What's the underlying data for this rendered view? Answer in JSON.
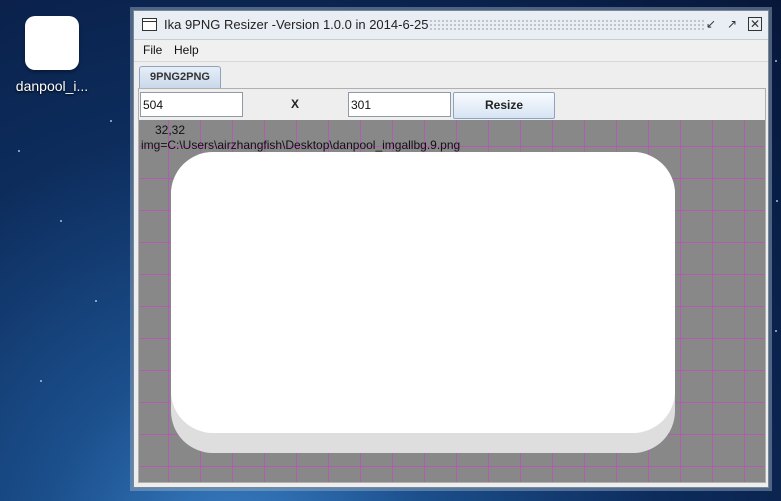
{
  "desktop": {
    "icon_label": "danpool_i..."
  },
  "window": {
    "title": "Ika 9PNG Resizer    -Version 1.0.0 in 2014-6-25",
    "controls": [
      "minimize-icon",
      "maximize-icon",
      "close-icon"
    ]
  },
  "menu": {
    "file": "File",
    "help": "Help"
  },
  "tabs": [
    {
      "label": "9PNG2PNG",
      "selected": true
    }
  ],
  "toolbar": {
    "width_value": "504",
    "separator": "X",
    "height_value": "301",
    "resize_label": "Resize"
  },
  "canvas": {
    "insets": "32,32",
    "image_path": "img=C:\\Users\\airzhangfish\\Desktop\\danpool_imgallbg.9.png",
    "background_color": "#888888",
    "grid_color": "#b05cb0"
  }
}
